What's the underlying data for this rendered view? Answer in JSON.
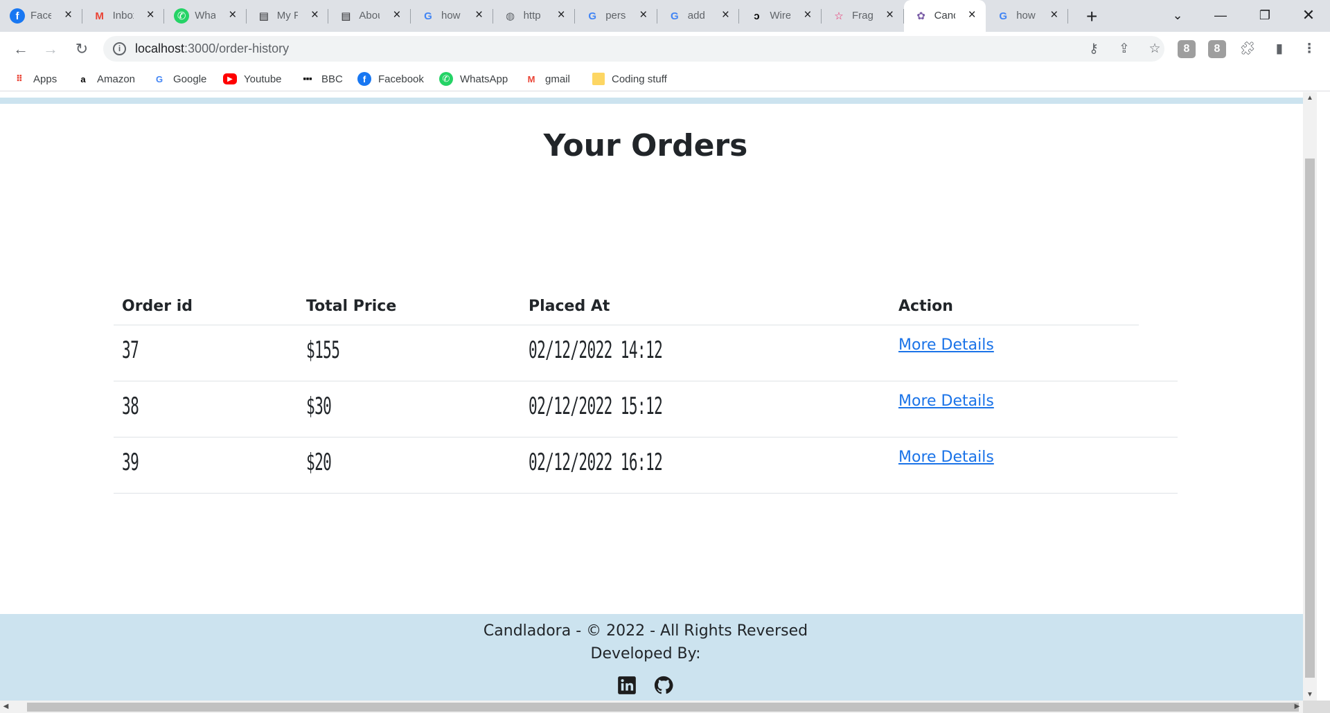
{
  "browser": {
    "tabs": [
      {
        "title": "Facebook",
        "icon": "facebook-icon",
        "color": "#1877f2"
      },
      {
        "title": "Inbox",
        "icon": "gmail-icon",
        "color": "#ea4335"
      },
      {
        "title": "WhatsApp",
        "icon": "whatsapp-icon",
        "color": "#25d366"
      },
      {
        "title": "My Files",
        "icon": "document-icon",
        "color": "#202124"
      },
      {
        "title": "About",
        "icon": "document-icon",
        "color": "#202124"
      },
      {
        "title": "how",
        "icon": "google-icon",
        "color": "#4285f4"
      },
      {
        "title": "http",
        "icon": "globe-icon",
        "color": "#5f6368"
      },
      {
        "title": "pers",
        "icon": "google-icon",
        "color": "#4285f4"
      },
      {
        "title": "add",
        "icon": "google-icon",
        "color": "#4285f4"
      },
      {
        "title": "Wire",
        "icon": "wire-icon",
        "color": "#000000"
      },
      {
        "title": "Frag",
        "icon": "star-icon",
        "color": "#e91e63"
      },
      {
        "title": "Cand",
        "icon": "candle-icon",
        "color": "#7b5ea7",
        "active": true
      },
      {
        "title": "how",
        "icon": "google-icon",
        "color": "#4285f4"
      }
    ],
    "url_host": "localhost",
    "url_path": ":3000/order-history",
    "bookmarks": [
      {
        "label": "Apps",
        "icon": "apps-grid-icon"
      },
      {
        "label": "Amazon",
        "icon": "amazon-icon"
      },
      {
        "label": "Google",
        "icon": "google-icon"
      },
      {
        "label": "Youtube",
        "icon": "youtube-icon"
      },
      {
        "label": "BBC",
        "icon": "bbc-icon"
      },
      {
        "label": "Facebook",
        "icon": "facebook-icon"
      },
      {
        "label": "WhatsApp",
        "icon": "whatsapp-icon"
      },
      {
        "label": "gmail",
        "icon": "gmail-icon"
      },
      {
        "label": "Coding stuff",
        "icon": "folder-icon"
      }
    ],
    "extension_badges": [
      "8",
      "8"
    ]
  },
  "page": {
    "title": "Your Orders",
    "table": {
      "headers": [
        "Order id",
        "Total Price",
        "Placed At",
        "Action"
      ],
      "rows": [
        {
          "id": "37",
          "price": "$155",
          "placed_at": "02/12/2022 14:12",
          "action": "More Details"
        },
        {
          "id": "38",
          "price": "$30",
          "placed_at": "02/12/2022 15:12",
          "action": "More Details"
        },
        {
          "id": "39",
          "price": "$20",
          "placed_at": "02/12/2022 16:12",
          "action": "More Details"
        }
      ]
    },
    "footer": {
      "copyright": "Candladora - © 2022 - All Rights Reversed",
      "developed_by": "Developed By:",
      "social": [
        "linkedin-icon",
        "github-icon"
      ]
    }
  },
  "colors": {
    "accent_band": "#cce3ef",
    "link": "#1a73e8",
    "text": "#212529"
  }
}
